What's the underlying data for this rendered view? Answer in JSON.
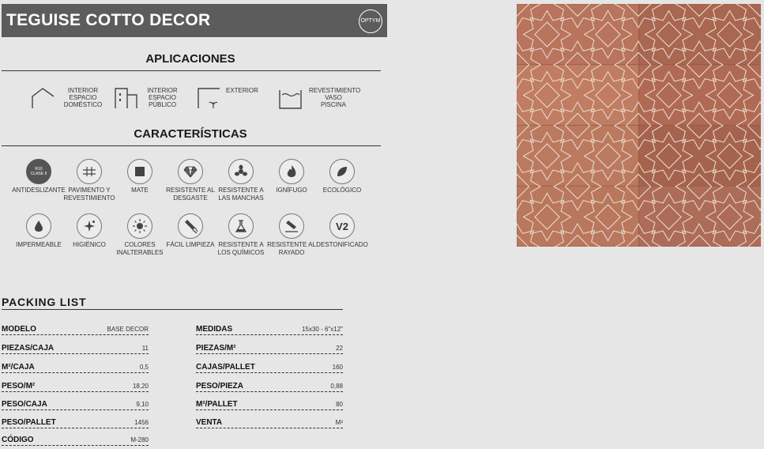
{
  "header": {
    "title": "TEGUISE COTTO DECOR",
    "brand": "OPTYM"
  },
  "aplicaciones": {
    "title": "APLICACIONES",
    "items": [
      {
        "icon": "house-icon",
        "label": "INTERIOR\nESPACIO\nDOMÉSTICO"
      },
      {
        "icon": "building-icon",
        "label": "INTERIOR\nESPACIO\nPÚBLICO"
      },
      {
        "icon": "exterior-plant-icon",
        "label": "EXTERIOR"
      },
      {
        "icon": "pool-icon",
        "label": "REVESTIMIENTO\nVASO\nPISCINA"
      }
    ]
  },
  "caracteristicas": {
    "title": "CARACTERÍSTICAS",
    "badge_text": "R10\nCLASE II",
    "items": [
      {
        "icon": "anti-slip-icon",
        "label": "ANTIDESLIZANTE"
      },
      {
        "icon": "floor-wall-icon",
        "label": "PAVIMENTO Y\nREVESTIMIENTO"
      },
      {
        "icon": "matte-icon",
        "label": "MATE"
      },
      {
        "icon": "diamond-icon",
        "label": "RESISTENTE AL\nDESGASTE"
      },
      {
        "icon": "stain-icon",
        "label": "RESISTENTE A\nLAS MANCHAS"
      },
      {
        "icon": "fire-icon",
        "label": "IGNÍFUGO"
      },
      {
        "icon": "leaf-icon",
        "label": "ECOLÓGICO"
      },
      {
        "icon": "water-drop-icon",
        "label": "IMPERMEABLE"
      },
      {
        "icon": "hygiene-icon",
        "label": "HIGIÉNICO"
      },
      {
        "icon": "sun-icon",
        "label": "COLORES\nINALTERABLES"
      },
      {
        "icon": "cleaning-icon",
        "label": "FÁCIL LIMPIEZA"
      },
      {
        "icon": "chemical-icon",
        "label": "RESISTENTE A\nLOS QUÍMICOS"
      },
      {
        "icon": "scratch-icon",
        "label": "RESISTENTE AL\nRAYADO"
      },
      {
        "icon": "v2-icon",
        "label": "DESTONIFICADO",
        "glyph": "V2"
      }
    ]
  },
  "packing": {
    "title": "PACKING LIST",
    "left": [
      {
        "key": "MODELO",
        "value": "BASE DECOR"
      },
      {
        "key": "PIEZAS/CAJA",
        "value": "11"
      },
      {
        "key": "M²/CAJA",
        "value": "0,5"
      },
      {
        "key": "PESO/M²",
        "value": "18,20"
      },
      {
        "key": "PESO/CAJA",
        "value": "9,10"
      },
      {
        "key": "PESO/PALLET",
        "value": "1456"
      },
      {
        "key": "CÓDIGO",
        "value": "M-280"
      }
    ],
    "right": [
      {
        "key": "MEDIDAS",
        "value": "15x30 - 6\"x12\""
      },
      {
        "key": "PIEZAS/M²",
        "value": "22"
      },
      {
        "key": "CAJAS/PALLET",
        "value": "160"
      },
      {
        "key": "PESO/PIEZA",
        "value": "0,88"
      },
      {
        "key": "M²/PALLET",
        "value": "80"
      },
      {
        "key": "VENTA",
        "value": "M²"
      }
    ]
  },
  "colors": {
    "header_bg": "#5c5c5c",
    "tile_base": "#b56f57",
    "tile_line": "#e9d6c8"
  }
}
